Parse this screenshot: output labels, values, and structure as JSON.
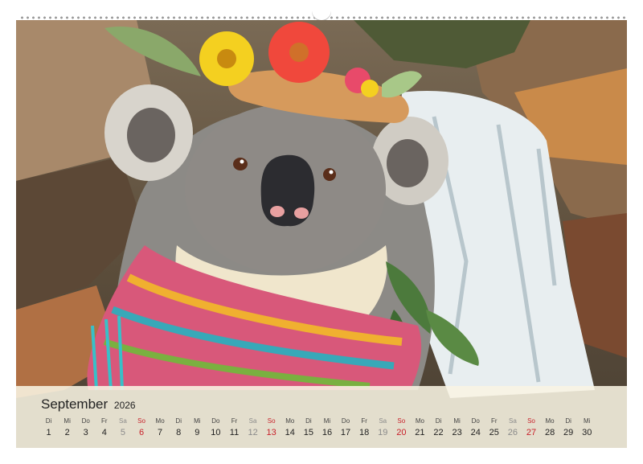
{
  "calendar": {
    "month": "September",
    "year": "2026",
    "days": [
      {
        "dow": "Di",
        "num": "1",
        "kind": "weekday"
      },
      {
        "dow": "Mi",
        "num": "2",
        "kind": "weekday"
      },
      {
        "dow": "Do",
        "num": "3",
        "kind": "weekday"
      },
      {
        "dow": "Fr",
        "num": "4",
        "kind": "weekday"
      },
      {
        "dow": "Sa",
        "num": "5",
        "kind": "sat"
      },
      {
        "dow": "So",
        "num": "6",
        "kind": "sun"
      },
      {
        "dow": "Mo",
        "num": "7",
        "kind": "weekday"
      },
      {
        "dow": "Di",
        "num": "8",
        "kind": "weekday"
      },
      {
        "dow": "Mi",
        "num": "9",
        "kind": "weekday"
      },
      {
        "dow": "Do",
        "num": "10",
        "kind": "weekday"
      },
      {
        "dow": "Fr",
        "num": "11",
        "kind": "weekday"
      },
      {
        "dow": "Sa",
        "num": "12",
        "kind": "sat"
      },
      {
        "dow": "So",
        "num": "13",
        "kind": "sun"
      },
      {
        "dow": "Mo",
        "num": "14",
        "kind": "weekday"
      },
      {
        "dow": "Di",
        "num": "15",
        "kind": "weekday"
      },
      {
        "dow": "Mi",
        "num": "16",
        "kind": "weekday"
      },
      {
        "dow": "Do",
        "num": "17",
        "kind": "weekday"
      },
      {
        "dow": "Fr",
        "num": "18",
        "kind": "weekday"
      },
      {
        "dow": "Sa",
        "num": "19",
        "kind": "sat"
      },
      {
        "dow": "So",
        "num": "20",
        "kind": "sun"
      },
      {
        "dow": "Mo",
        "num": "21",
        "kind": "weekday"
      },
      {
        "dow": "Di",
        "num": "22",
        "kind": "weekday"
      },
      {
        "dow": "Mi",
        "num": "23",
        "kind": "weekday"
      },
      {
        "dow": "Do",
        "num": "24",
        "kind": "weekday"
      },
      {
        "dow": "Fr",
        "num": "25",
        "kind": "weekday"
      },
      {
        "dow": "Sa",
        "num": "26",
        "kind": "sat"
      },
      {
        "dow": "So",
        "num": "27",
        "kind": "sun"
      },
      {
        "dow": "Mo",
        "num": "28",
        "kind": "weekday"
      },
      {
        "dow": "Di",
        "num": "29",
        "kind": "weekday"
      },
      {
        "dow": "Mi",
        "num": "30",
        "kind": "weekday"
      }
    ]
  },
  "colors": {
    "sunday": "#c8202a",
    "saturday": "#8a8a8a",
    "weekday": "#222222",
    "calendar_strip": "#f8f4e2"
  }
}
